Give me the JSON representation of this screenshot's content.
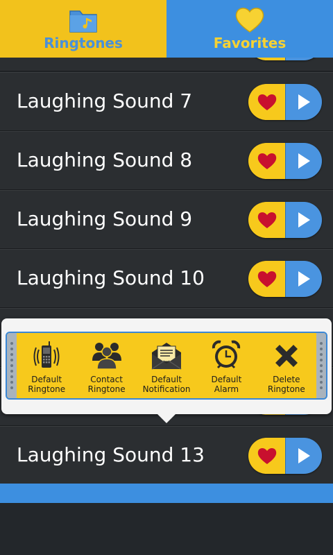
{
  "tabs": [
    {
      "label": "Ringtones",
      "icon": "folder-music-icon",
      "active": true
    },
    {
      "label": "Favorites",
      "icon": "heart-icon",
      "active": false
    }
  ],
  "rows": [
    {
      "label": "Laughing Sound 7"
    },
    {
      "label": "Laughing Sound 8"
    },
    {
      "label": "Laughing Sound 9"
    },
    {
      "label": "Laughing Sound 10"
    },
    {
      "label": "Laughing Sound 13"
    }
  ],
  "context_menu": {
    "actions": [
      {
        "label": "Default\nRingtone",
        "icon": "phone-ringing-icon"
      },
      {
        "label": "Contact\nRingtone",
        "icon": "contacts-group-icon"
      },
      {
        "label": "Default\nNotification",
        "icon": "envelope-icon"
      },
      {
        "label": "Default\nAlarm",
        "icon": "alarm-clock-icon"
      },
      {
        "label": "Delete\nRingtone",
        "icon": "delete-x-icon"
      }
    ]
  },
  "colors": {
    "yellow": "#f7c91c",
    "blue": "#3d8fe0",
    "row_bg": "#2b2e31",
    "heart": "#c8102e"
  }
}
